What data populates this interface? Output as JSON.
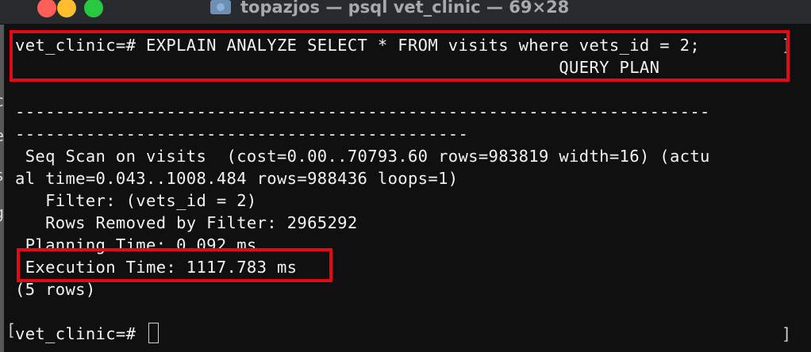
{
  "window": {
    "title": "topazjos — psql vet_clinic — 69×28"
  },
  "terminal": {
    "lines": [
      "vet_clinic=# EXPLAIN ANALYZE SELECT * FROM visits where vets_id = 2;",
      "                                                      QUERY PLAN",
      "",
      "---------------------------------------------------------------------",
      "---------------------------------------------",
      " Seq Scan on visits  (cost=0.00..70793.60 rows=983819 width=16) (actu",
      "al time=0.043..1008.484 rows=988436 loops=1)",
      "   Filter: (vets_id = 2)",
      "   Rows Removed by Filter: 2965292",
      " Planning Time: 0.092 ms",
      " Execution Time: 1117.783 ms",
      "(5 rows)",
      "",
      "vet_clinic=# "
    ]
  },
  "colors": {
    "highlight": "#e50914",
    "terminal_bg": "#101010",
    "text": "#f2f2f2"
  }
}
